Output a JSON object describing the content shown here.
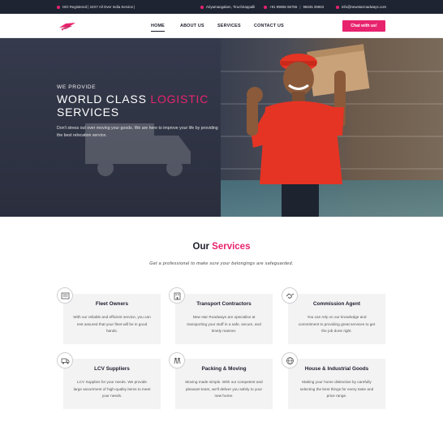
{
  "topbar": {
    "registered": "ISO Registered | 24X7 All Over India Service |",
    "address": "Ariyamangalam, Tiruchirappalli",
    "phone1": "+91 99655 55755",
    "phone2": "96635 35963",
    "email": "info@newstarroadways.com"
  },
  "header": {
    "nav": [
      "HOME",
      "ABOUT US",
      "SERVICES",
      "CONTACT US"
    ],
    "cta": "Chat with us!"
  },
  "hero": {
    "kicker": "WE PROVIDE",
    "headline_pre": "WORLD CLASS ",
    "headline_accent": "LOGISTIC",
    "headline_post": "SERVICES",
    "description": "Don't stress out over moving your goods. We are here to improve your life by providing the best relocation service."
  },
  "services": {
    "title_pre": "Our ",
    "title_accent": "Services",
    "subtitle": "Get a professional to make sure your belongings are safeguarded.",
    "cards": [
      {
        "title": "Fleet Owners",
        "text": "With our reliable and efficient service, you can rest assured that your fleet will be in good hands.",
        "icon": "fleet-icon"
      },
      {
        "title": "Transport Contractors",
        "text": "New star Roadways are specialise at transporting your stuff in a safe, secure, and timely manner.",
        "icon": "building-icon"
      },
      {
        "title": "Commission Agent",
        "text": "You can rely on our knowledge and commitment to providing great services to get the job done right.",
        "icon": "handshake-icon"
      },
      {
        "title": "LCV Suppliers",
        "text": "LCV Supplies for your needs. We provide large assortment of high-quality items to meet your needs.",
        "icon": "truck-icon"
      },
      {
        "title": "Packing & Moving",
        "text": "Moving made simple. With our competent and pleasant team, we'll deliver you safely to your new home.",
        "icon": "people-icon"
      },
      {
        "title": "House & Industrial Goods",
        "text": "Making your home distinctive by carefully selecting the best things for every taste and price range.",
        "icon": "globe-icon"
      }
    ]
  },
  "colors": {
    "accent": "#e8236e",
    "dark": "#1f2433"
  }
}
